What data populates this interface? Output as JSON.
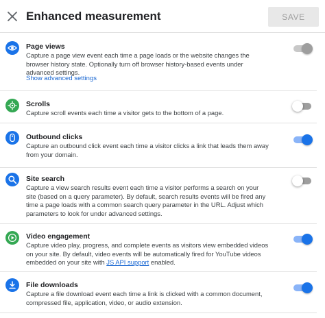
{
  "header": {
    "title": "Enhanced measurement",
    "save_label": "SAVE",
    "close_icon": "close-icon"
  },
  "colors": {
    "accent": "#1a73e8",
    "green_icon": "#34a853",
    "save_disabled_bg": "#e8e8e8",
    "link": "#1967d2"
  },
  "sections": [
    {
      "id": "page-views",
      "icon": "eye-icon",
      "title": "Page views",
      "description": "Capture a page view event each time a page loads or the website changes the browser history state. Optionally turn off browser history-based events under advanced settings.",
      "link": "Show advanced settings",
      "toggle": "on-disabled"
    },
    {
      "id": "scrolls",
      "icon": "crosshair-icon",
      "title": "Scrolls",
      "description": "Capture scroll events each time a visitor gets to the bottom of a page.",
      "toggle": "off"
    },
    {
      "id": "outbound-clicks",
      "icon": "mouse-icon",
      "title": "Outbound clicks",
      "description": "Capture an outbound click event each time a visitor clicks a link that leads them away from your domain.",
      "toggle": "on"
    },
    {
      "id": "site-search",
      "icon": "search-icon",
      "title": "Site search",
      "description": "Capture a view search results event each time a visitor performs a search on your site (based on a query parameter). By default, search results events will be fired any time a page loads with a common search query parameter in the URL. Adjust which parameters to look for under advanced settings.",
      "toggle": "off"
    },
    {
      "id": "video-engagement",
      "icon": "play-icon",
      "title": "Video engagement",
      "description_before": "Capture video play, progress, and complete events as visitors view embedded videos on your site. By default, video events will be automatically fired for YouTube videos embedded on your site with ",
      "description_link": "JS API support",
      "description_after": " enabled.",
      "toggle": "on"
    },
    {
      "id": "file-downloads",
      "icon": "download-icon",
      "title": "File downloads",
      "description": "Capture a file download event each time a link is clicked with a common document, compressed file, application, video, or audio extension.",
      "toggle": "on"
    }
  ]
}
